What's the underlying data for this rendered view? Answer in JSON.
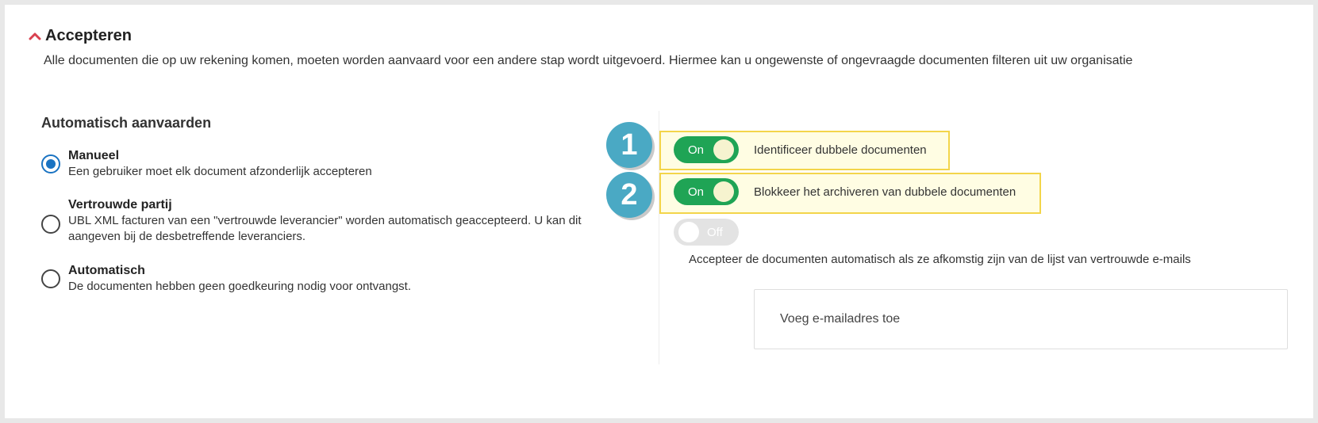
{
  "section": {
    "title": "Accepteren",
    "description": "Alle documenten die op uw rekening komen, moeten worden aanvaard voor een andere stap wordt uitgevoerd. Hiermee kan u ongewenste of ongevraagde documenten filteren uit uw organisatie",
    "chevron_icon": "chevron-up-icon",
    "accent_color": "#d9414f"
  },
  "auto_accept": {
    "title": "Automatisch aanvaarden",
    "selected": "manueel",
    "options": [
      {
        "id": "manueel",
        "label": "Manueel",
        "description": "Een gebruiker moet elk document afzonderlijk accepteren",
        "checked": true
      },
      {
        "id": "vertrouwde-partij",
        "label": "Vertrouwde partij",
        "description": "UBL XML facturen van een \"vertrouwde leverancier\" worden automatisch geaccepteerd. U kan dit aangeven bij de desbetreffende leveranciers.",
        "checked": false
      },
      {
        "id": "automatisch",
        "label": "Automatisch",
        "description": "De documenten hebben geen goedkeuring nodig voor ontvangst.",
        "checked": false
      }
    ]
  },
  "annotations": {
    "badge1": "1",
    "badge2": "2",
    "badge_color": "#4aa9c4",
    "highlight_color": "#f3d54a"
  },
  "toggles": [
    {
      "state": "On",
      "label": "Identificeer dubbele documenten",
      "on": true
    },
    {
      "state": "On",
      "label": "Blokkeer het archiveren van dubbele documenten",
      "on": true
    },
    {
      "state": "Off",
      "label": "",
      "on": false
    }
  ],
  "trusted_emails": {
    "description": "Accepteer de documenten automatisch als ze afkomstig zijn van de lijst van vertrouwde e-mails",
    "placeholder": "Voeg e-mailadres toe"
  },
  "colors": {
    "toggle_on": "#1fa455",
    "toggle_off": "#e3e3e3",
    "radio_checked": "#1a73c2"
  }
}
